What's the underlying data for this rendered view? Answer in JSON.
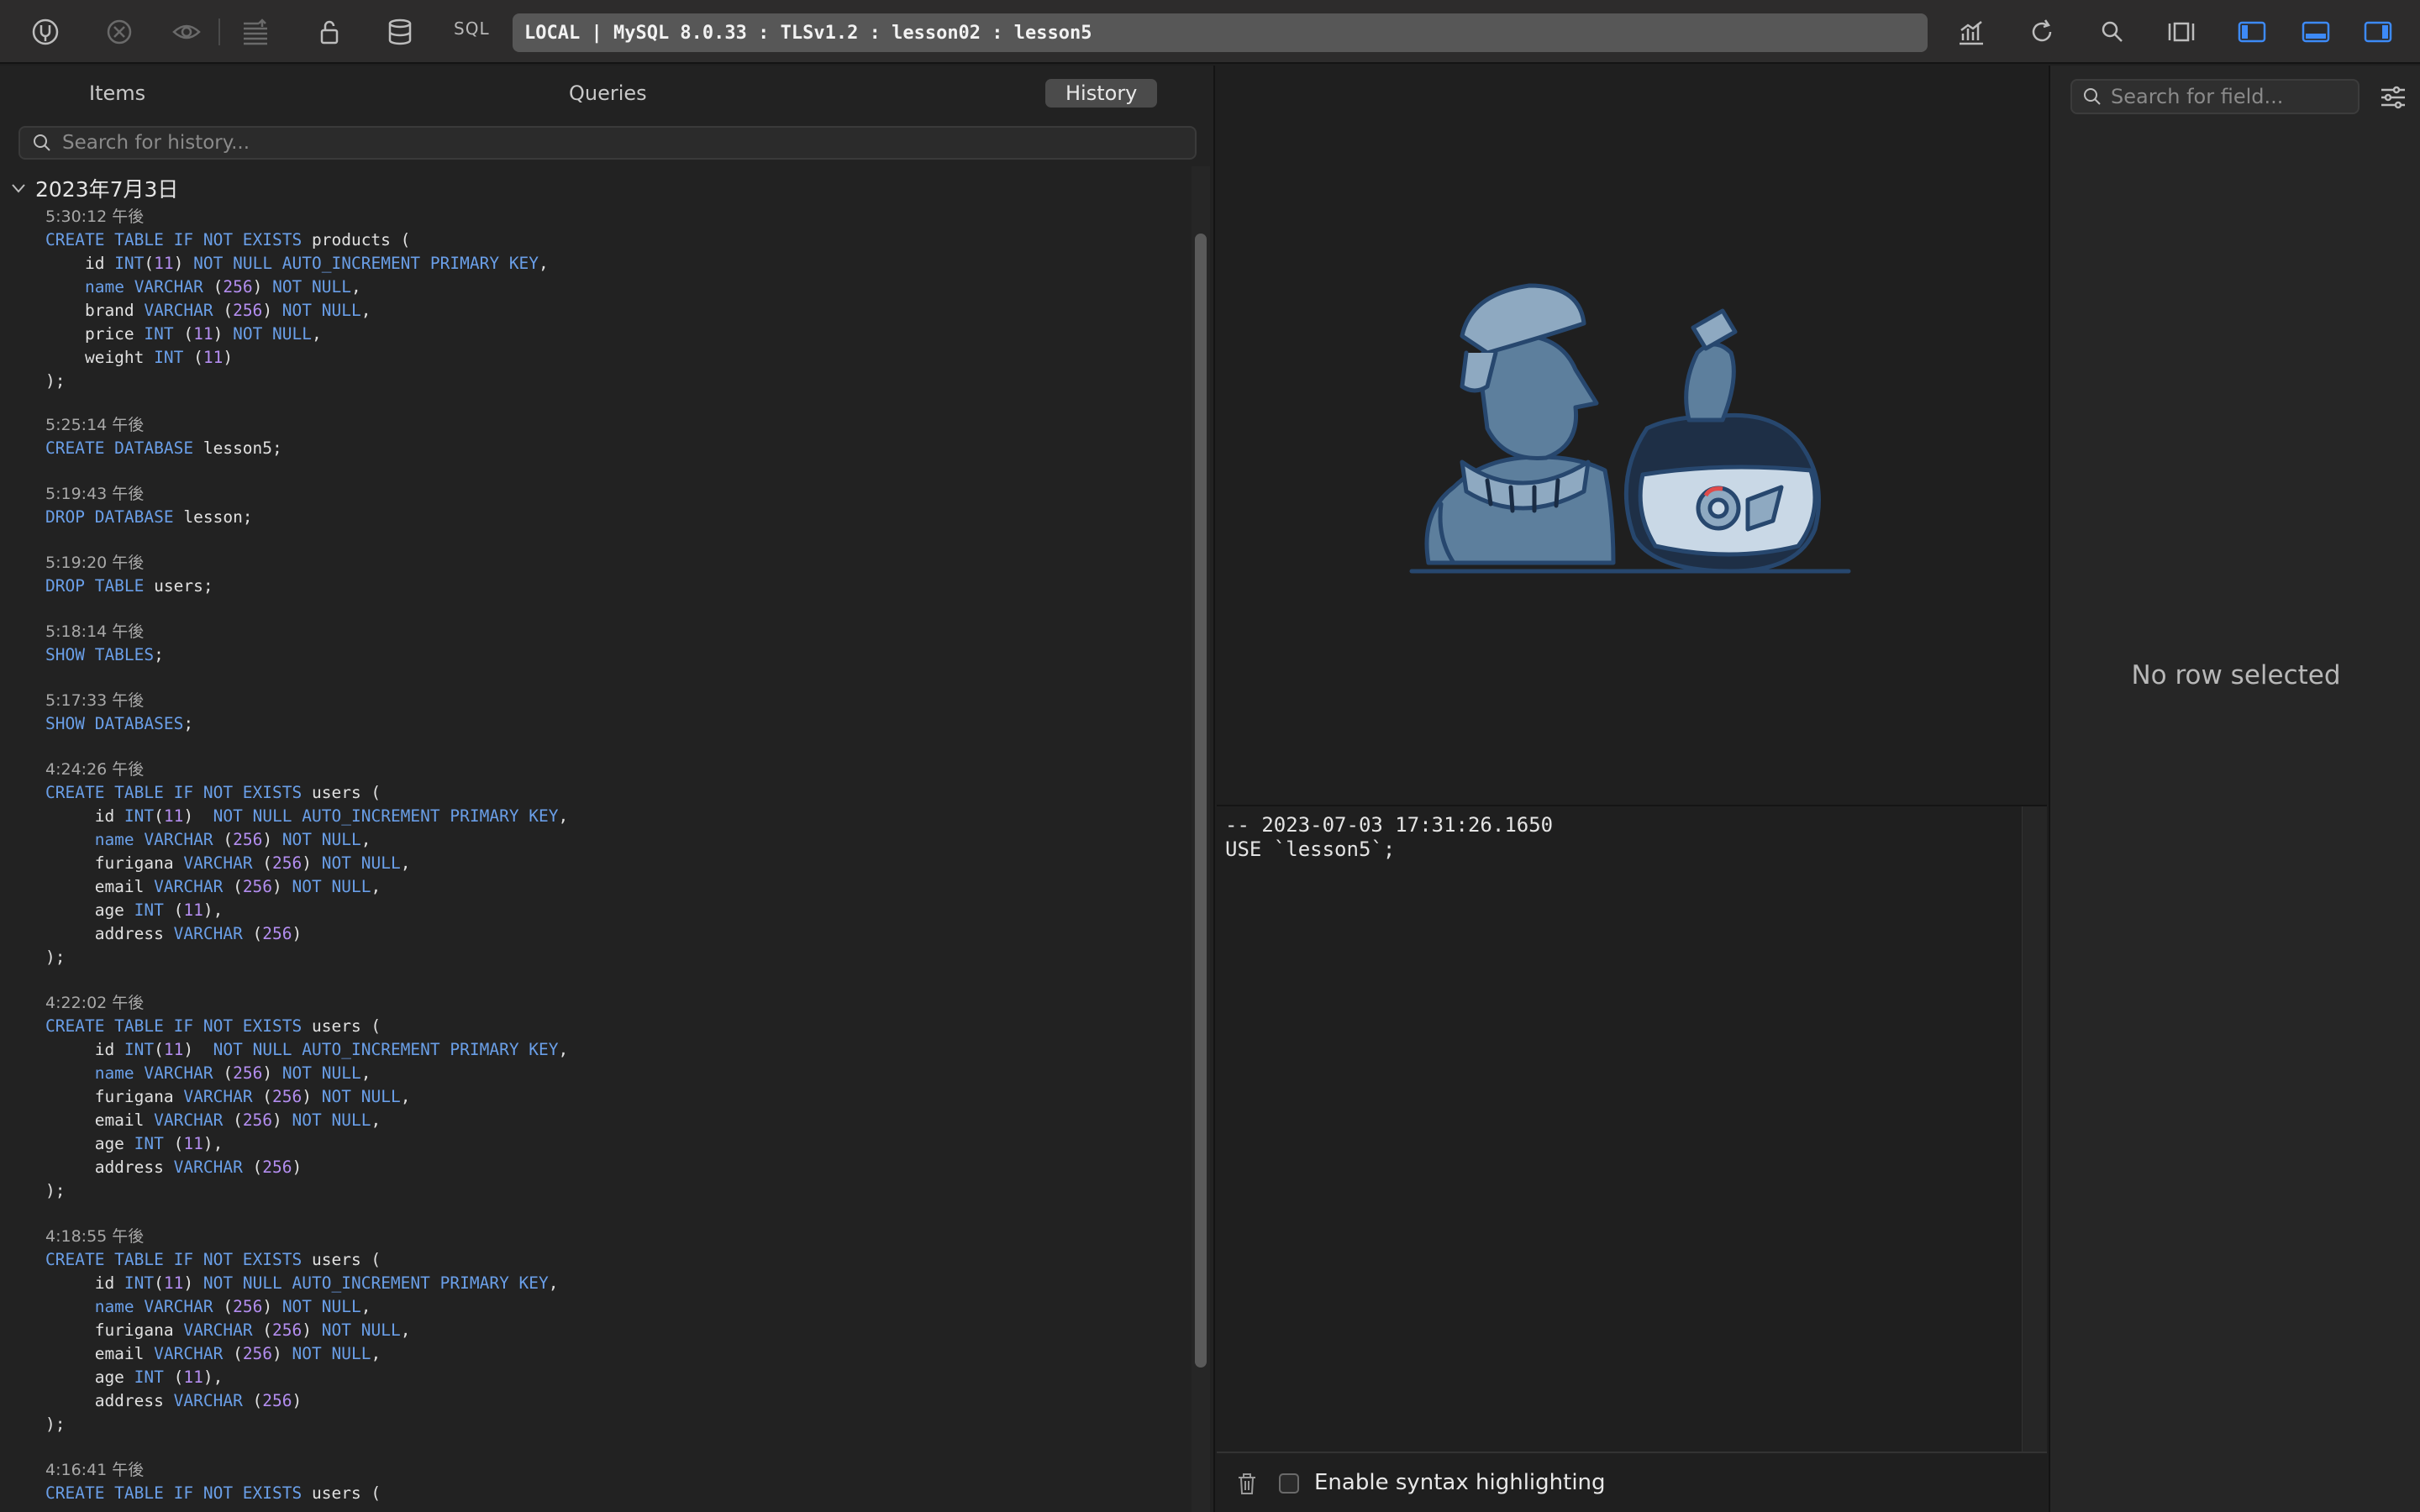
{
  "toolbar": {
    "sql_label": "SQL",
    "connection": "LOCAL | MySQL 8.0.33 : TLSv1.2 : lesson02 : lesson5",
    "icons": [
      "connection-icon",
      "close-icon",
      "eye-icon",
      "list-indent-icon",
      "lock-icon",
      "database-icon",
      "chart-icon",
      "refresh-icon",
      "search-icon",
      "split-view-icon",
      "left-sidebar-icon",
      "bottom-panel-icon",
      "right-sidebar-icon"
    ],
    "accent": "#3d8af7"
  },
  "left_tabs": {
    "items": "Items",
    "queries": "Queries",
    "history": "History"
  },
  "history_search": {
    "placeholder": "Search for history..."
  },
  "history": {
    "date": "2023年7月3日",
    "entries": [
      {
        "time": "5:30:12 午後"
      },
      {
        "time": "5:25:14 午後"
      },
      {
        "time": "5:19:43 午後"
      },
      {
        "time": "5:19:20 午後"
      },
      {
        "time": "5:18:14 午後"
      },
      {
        "time": "5:17:33 午後"
      },
      {
        "time": "4:24:26 午後"
      },
      {
        "time": "4:22:02 午後"
      },
      {
        "time": "4:18:55 午後"
      },
      {
        "time": "4:16:41 午後"
      }
    ]
  },
  "console": {
    "line1": "-- 2023-07-03 17:31:26.1650",
    "line2": "USE `lesson5`;",
    "syntax_label": "Enable syntax highlighting"
  },
  "right_panel": {
    "search_placeholder": "Search for field...",
    "empty_text": "No row selected"
  }
}
